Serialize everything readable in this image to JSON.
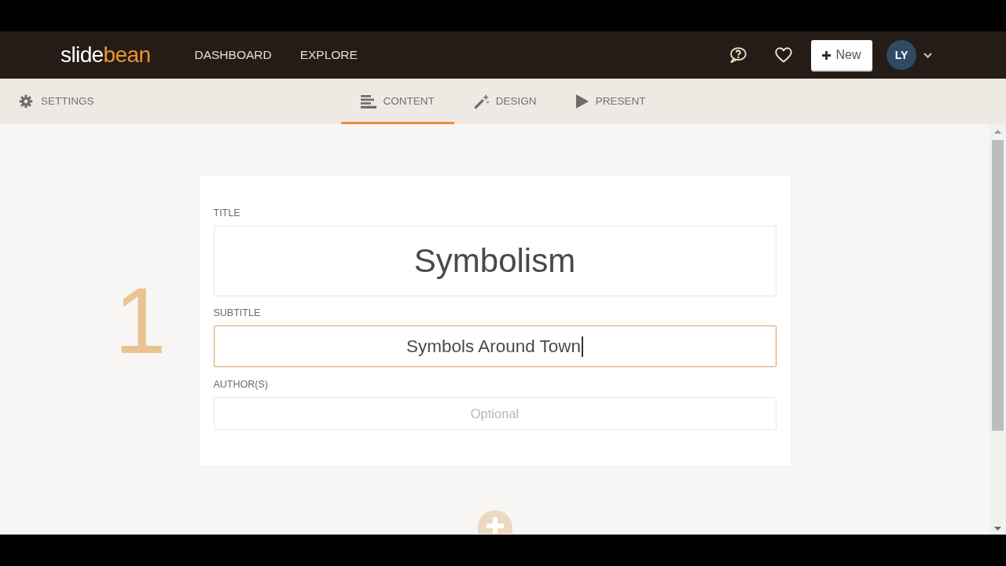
{
  "header": {
    "logo": [
      "slide",
      "bean"
    ],
    "nav": [
      {
        "label": "DASHBOARD"
      },
      {
        "label": "EXPLORE"
      }
    ],
    "new_button": {
      "label": "New"
    },
    "user": {
      "initials": "LY"
    }
  },
  "toolbar": {
    "settings": {
      "label": "SETTINGS"
    },
    "tabs": [
      {
        "label": "CONTENT",
        "selected": true
      },
      {
        "label": "DESIGN",
        "selected": false
      },
      {
        "label": "PRESENT",
        "selected": false
      }
    ]
  },
  "slide": {
    "number": "1",
    "fields": [
      {
        "kind": "title",
        "label": "TITLE",
        "value": "Symbolism",
        "focused": false
      },
      {
        "kind": "subtitle",
        "label": "SUBTITLE",
        "value": "Symbols Around Town",
        "focused": true
      },
      {
        "kind": "author",
        "label": "AUTHOR(S)",
        "placeholder": "Optional",
        "focused": false
      }
    ]
  }
}
